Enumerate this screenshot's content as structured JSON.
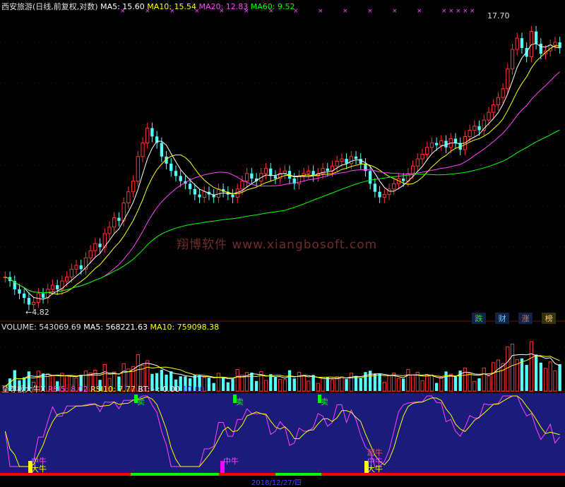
{
  "price_header": {
    "title": "西安旅游(日线,前复权,对数)",
    "ma5": "MA5: 15.60",
    "ma10": "MA10: 15.54",
    "ma20": "MA20: 12.83",
    "ma60": "MA60: 9.52"
  },
  "price_labels": {
    "high": "17.70",
    "low": "4.82",
    "watermark": "翔博软件 www.xiangbosoft.com"
  },
  "legend_buttons": [
    "跌",
    "财",
    "涨",
    "榜"
  ],
  "volume_header": {
    "label": "VOLUME: 543069.69",
    "ma5": "MA5: 568221.63",
    "ma10": "MA10: 759098.38"
  },
  "indicator_header": {
    "name": "至尊板大牛X",
    "rsi5": "RSI5: 8.02",
    "rsi10": "RSI10: 7.77",
    "bt": "BT: - : 0.00",
    "level": "10.00"
  },
  "indicator_marks": {
    "sell": "卖",
    "mid_bull": "中牛",
    "big_bull": "大牛",
    "super_bull": "超牛"
  },
  "bottom_date": "2018/12/27/四",
  "colors": {
    "up": "#ff3333",
    "down": "#54ffff",
    "ma5": "#ffffff",
    "ma10": "#ffff00",
    "ma20": "#ff44ff",
    "ma60": "#00ff00",
    "indicator_bg": "#1b1b7a"
  },
  "chart_data": {
    "type": "candlestick",
    "y_scale": "log",
    "price_range": [
      4.82,
      17.7
    ],
    "closes": [
      5.6,
      5.5,
      5.3,
      5.2,
      5.1,
      4.95,
      5.0,
      5.2,
      5.1,
      5.3,
      5.4,
      5.3,
      5.5,
      5.6,
      5.8,
      5.9,
      5.8,
      6.1,
      6.3,
      6.5,
      6.4,
      6.8,
      7.0,
      7.3,
      7.2,
      7.8,
      8.2,
      8.6,
      9.6,
      10.2,
      10.9,
      10.5,
      10.2,
      9.6,
      9.3,
      9.0,
      8.8,
      8.6,
      8.5,
      8.3,
      8.1,
      8.0,
      8.2,
      8.1,
      8.0,
      8.3,
      8.2,
      8.1,
      8.0,
      8.3,
      8.6,
      8.9,
      8.7,
      8.6,
      8.9,
      9.1,
      8.8,
      8.7,
      8.9,
      9.0,
      8.7,
      8.5,
      8.8,
      8.9,
      9.0,
      8.8,
      8.9,
      9.1,
      9.0,
      9.2,
      9.4,
      9.5,
      9.3,
      9.6,
      9.5,
      9.3,
      9.0,
      8.5,
      8.2,
      8.0,
      8.1,
      8.3,
      8.5,
      8.7,
      8.6,
      8.9,
      9.2,
      9.5,
      9.7,
      10.0,
      10.2,
      10.1,
      10.3,
      10.0,
      10.4,
      10.2,
      9.9,
      10.5,
      10.8,
      11.0,
      10.8,
      11.3,
      11.7,
      12.1,
      12.5,
      13.0,
      14.2,
      15.5,
      16.3,
      15.6,
      15.0,
      16.8,
      15.9,
      15.2,
      15.4,
      15.8,
      16.0,
      15.6
    ],
    "volume_header_value": 543069.69
  }
}
